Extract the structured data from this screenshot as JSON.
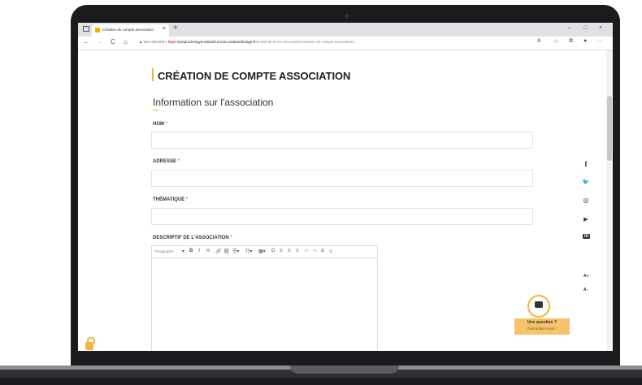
{
  "browser": {
    "tab_title": "Création de compte association",
    "tab_close": "×",
    "new_tab": "+",
    "window_controls": [
      "–",
      "□",
      "×"
    ],
    "nav": {
      "back": "←",
      "forward": "→",
      "reload": "C",
      "home": "⌂"
    },
    "url": {
      "warning_icon": "▲",
      "not_secure": "Non sécurisé",
      "separator": "|",
      "scheme": "https://",
      "host": "preprodcrepyenvaloisfr.srv15.createurdimage.fr",
      "path": "/portail-de-la-vie-associative/creation-de-compte-association/"
    },
    "right_icons": [
      "A",
      "☆",
      "⧉",
      "●",
      "···"
    ]
  },
  "page": {
    "title": "CRÉATION DE COMPTE ASSOCIATION",
    "section_title": "Information sur l'association",
    "fields": [
      {
        "label": "NOM",
        "required": "*"
      },
      {
        "label": "ADRESSE",
        "required": "*"
      },
      {
        "label": "THÉMATIQUE",
        "required": "*"
      },
      {
        "label": "DESCRIPTIF DE L'ASSOCIATION",
        "required": "*"
      }
    ],
    "editor": {
      "paragraph_select": "Paragraphe",
      "toolbar_items": [
        "▾",
        "B",
        "I",
        "X²",
        "🔗",
        "⛓",
        "☰▾",
        "☷▾",
        "▦▾",
        "Ω",
        "≡",
        "≡",
        "≡",
        "↶",
        "↷",
        "⧄",
        "◇"
      ]
    }
  },
  "social": [
    {
      "name": "facebook-icon",
      "glyph": "f"
    },
    {
      "name": "twitter-icon",
      "glyph": "🐦"
    },
    {
      "name": "instagram-icon",
      "glyph": "◎"
    },
    {
      "name": "youtube-icon",
      "glyph": "▶"
    },
    {
      "name": "linkedin-icon",
      "glyph": "in"
    }
  ],
  "text_size": {
    "increase": "A+",
    "decrease": "A-"
  },
  "chat": {
    "title": "Une question ?",
    "subtitle": "Demandez-nous !"
  },
  "colors": {
    "accent": "#f3b43a",
    "chat_bg": "#f6c36b",
    "required": "#e07b7b"
  }
}
